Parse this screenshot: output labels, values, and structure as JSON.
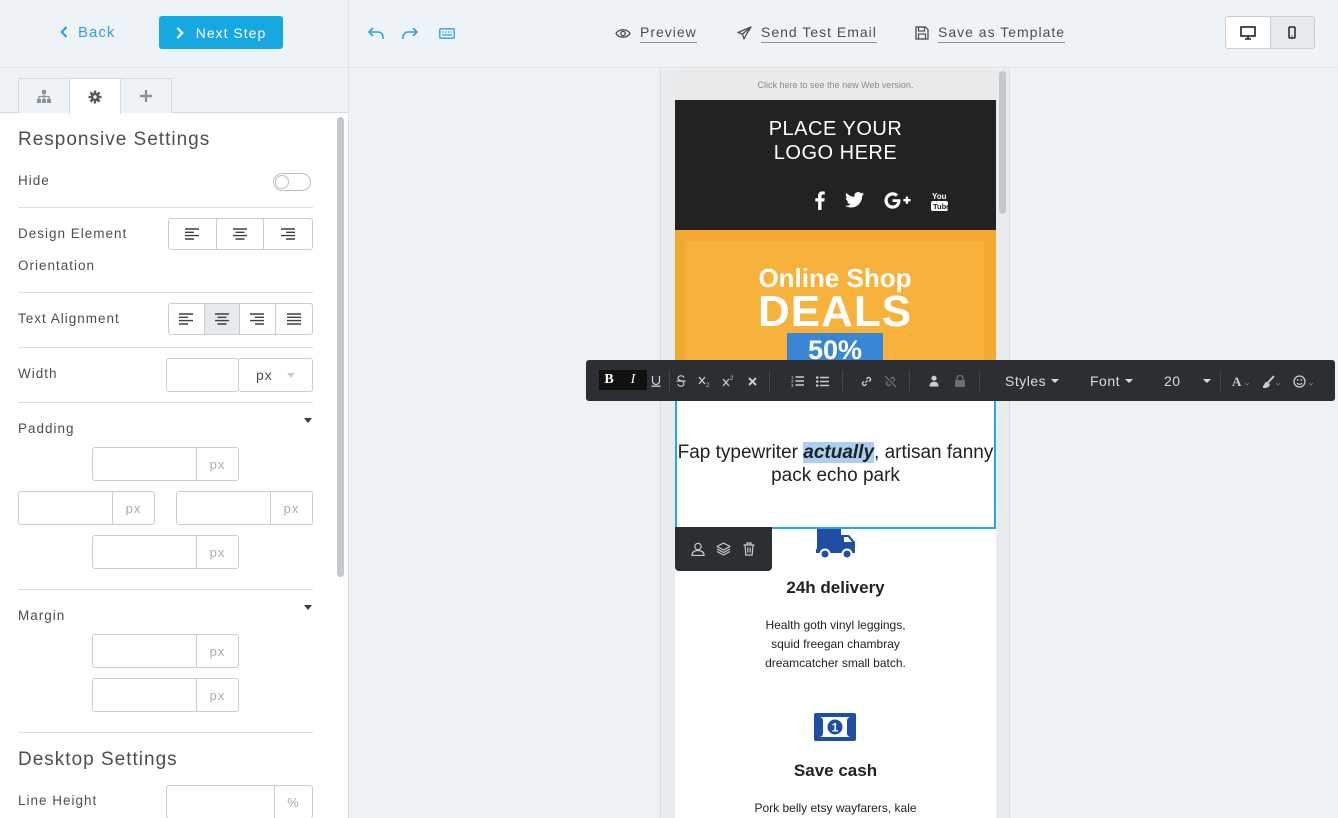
{
  "header": {
    "back_label": "Back",
    "next_label": "Next Step"
  },
  "sidebar": {
    "tabs": [
      {
        "icon": "sitemap-icon"
      },
      {
        "icon": "gear-icon",
        "active": true
      },
      {
        "icon": "plus-icon"
      }
    ],
    "responsive_title": "Responsive Settings",
    "hide_label": "Hide",
    "hide_toggle": false,
    "orientation_label_1": "Design Element",
    "orientation_label_2": "Orientation",
    "text_alignment_label": "Text Alignment",
    "text_alignment_selected": "center",
    "width_label": "Width",
    "width_unit": "px",
    "padding_label": "Padding",
    "margin_label": "Margin",
    "unit_px": "px",
    "desktop_title": "Desktop Settings",
    "line_height_label": "Line Height",
    "line_height_unit": "%"
  },
  "topbar": {
    "preview": "Preview",
    "send_test": "Send Test Email",
    "save_template": "Save as Template",
    "device_selected": "mobile"
  },
  "rte": {
    "styles": "Styles",
    "font": "Font",
    "size": "20",
    "buttons": [
      "bold",
      "italic",
      "underline",
      "strikethrough",
      "subscript",
      "superscript",
      "clear-format",
      "ordered-list",
      "unordered-list",
      "link",
      "unlink",
      "person",
      "lock",
      "text-color",
      "brush",
      "emoji"
    ]
  },
  "email": {
    "web_version": "Click here to see the new Web version.",
    "logo": "PLACE YOUR\nLOGO HERE",
    "banner_line1": "Online Shop",
    "banner_line2": "DEALS",
    "banner_badge": "50%",
    "text_before": "Fap typewriter ",
    "text_highlight": "actually",
    "text_after": ", artisan fanny pack echo park",
    "feature1_title": "24h delivery",
    "feature1_body": "Health goth vinyl leggings,\nsquid freegan chambray\ndreamcatcher small batch.",
    "feature2_title": "Save cash",
    "feature2_body": "Pork belly etsy wayfarers, kale"
  },
  "colors": {
    "accent": "#16a8e0",
    "selection_border": "#2aa6df",
    "banner": "#f7b23b",
    "badge": "#3a86d6",
    "icon_blue": "#1f4ea3"
  }
}
